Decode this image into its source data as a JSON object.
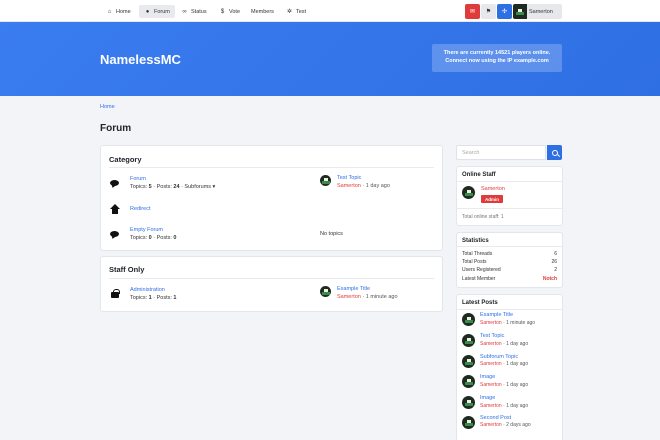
{
  "nav": {
    "items": [
      {
        "label": "Home",
        "icon": "home-icon"
      },
      {
        "label": "Forum",
        "icon": "comments-icon"
      },
      {
        "label": "Status",
        "icon": "binoculars-icon"
      },
      {
        "label": "Vote",
        "icon": "dollar-icon"
      },
      {
        "label": "Members",
        "icon": ""
      },
      {
        "label": "Test",
        "icon": "cogs-icon"
      }
    ],
    "active": "Forum",
    "user": "Samerton"
  },
  "hero": {
    "site_title": "NamelessMC",
    "server_line1": "There are currently 14521 players online.",
    "server_line2": "Connect now using the IP example.com"
  },
  "breadcrumb": "Home",
  "page_title": "Forum",
  "categories": [
    {
      "title": "Category",
      "forums": [
        {
          "icon": "comment-icon",
          "name": "Forum",
          "topics_label": "Topics: ",
          "topics": "5",
          "posts_label": " · Posts: ",
          "posts": "24",
          "extra": " · Subforums ▾",
          "latest_title": "Test Topic",
          "latest_user": "Samerton",
          "latest_time": " · 1 day ago"
        },
        {
          "icon": "home-icon",
          "name": "Redirect"
        },
        {
          "icon": "comment-icon",
          "name": "Empty Forum",
          "topics_label": "Topics: ",
          "topics": "0",
          "posts_label": " · Posts: ",
          "posts": "0",
          "no_topics": "No topics"
        }
      ]
    },
    {
      "title": "Staff Only",
      "forums": [
        {
          "icon": "lock-icon",
          "name": "Administration",
          "topics_label": "Topics: ",
          "topics": "1",
          "posts_label": " · Posts: ",
          "posts": "1",
          "latest_title": "Example Title",
          "latest_user": "Samerton",
          "latest_time": " · 1 minute ago"
        }
      ]
    }
  ],
  "sidebar": {
    "search_placeholder": "Search",
    "online_staff": {
      "title": "Online Staff",
      "user": "Samerton",
      "badge": "Admin",
      "total": "Total online staff: 1"
    },
    "statistics": {
      "title": "Statistics",
      "rows": [
        {
          "label": "Total Threads",
          "value": "6"
        },
        {
          "label": "Total Posts",
          "value": "26"
        },
        {
          "label": "Users Registered",
          "value": "2"
        },
        {
          "label": "Latest Member",
          "value": "Notch"
        }
      ]
    },
    "latest_posts": {
      "title": "Latest Posts",
      "items": [
        {
          "title": "Example Title",
          "user": "Samerton",
          "time": " · 1 minute ago"
        },
        {
          "title": "Test Topic",
          "user": "Samerton",
          "time": " · 1 day ago"
        },
        {
          "title": "Subforum Topic",
          "user": "Samerton",
          "time": " · 1 day ago"
        },
        {
          "title": "Image",
          "user": "Samerton",
          "time": " · 1 day ago"
        },
        {
          "title": "Image",
          "user": "Samerton",
          "time": " · 1 day ago"
        },
        {
          "title": "Second Post",
          "user": "Samerton",
          "time": " · 2 days ago"
        }
      ]
    }
  },
  "colors": {
    "accent": "#2f6fe4",
    "danger": "#e03b3b",
    "hero": "#3a7df0"
  }
}
